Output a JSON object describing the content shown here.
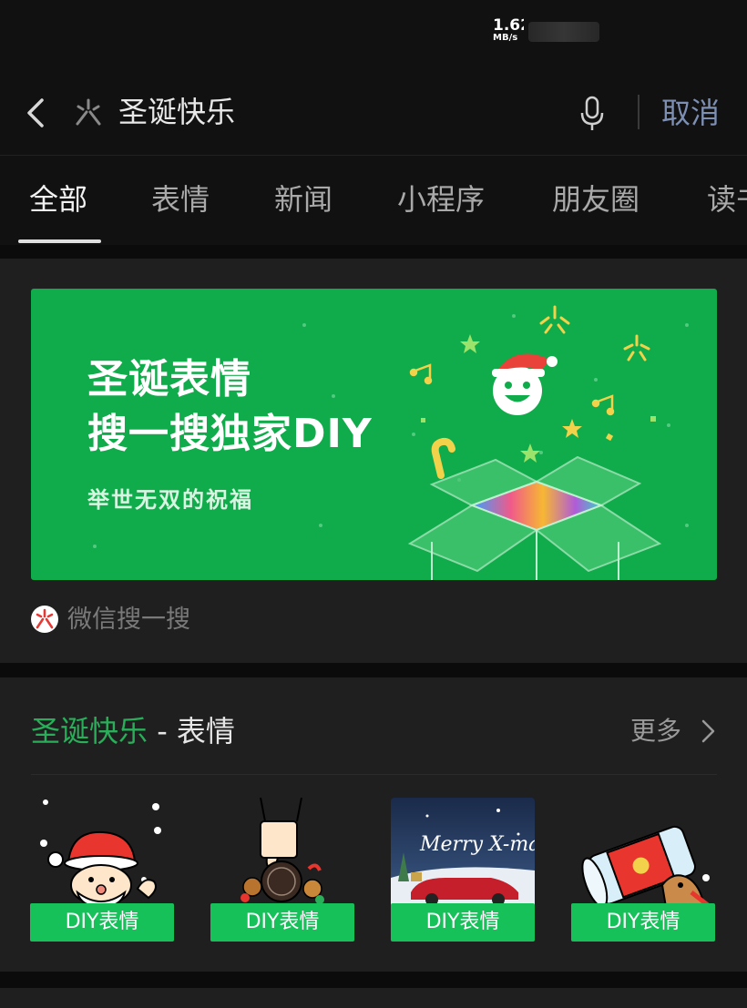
{
  "status_bar": {
    "net_speed_value": "1.62",
    "net_speed_unit": "MB/s"
  },
  "search": {
    "query": "圣诞快乐",
    "cancel_label": "取消"
  },
  "tabs": [
    {
      "label": "全部",
      "active": true
    },
    {
      "label": "表情"
    },
    {
      "label": "新闻"
    },
    {
      "label": "小程序"
    },
    {
      "label": "朋友圈"
    },
    {
      "label": "读书"
    }
  ],
  "banner": {
    "title_line1": "圣诞表情",
    "title_line2": "搜一搜独家DIY",
    "subtitle": "举世无双的祝福",
    "bg_color": "#10ab4a"
  },
  "source": {
    "label": "微信搜一搜"
  },
  "sticker_section": {
    "keyword": "圣诞快乐",
    "suffix": " - 表情",
    "more_label": "更多",
    "accent_color": "#2aae5a",
    "items": [
      {
        "label": "DIY表情",
        "icon": "santa-sticker"
      },
      {
        "label": "DIY表情",
        "icon": "cookie-hand-sticker"
      },
      {
        "label": "DIY表情",
        "icon": "merry-xmas-car-sticker",
        "text_art": "Merry X-mas"
      },
      {
        "label": "DIY表情",
        "icon": "red-bucket-sticker"
      }
    ]
  }
}
